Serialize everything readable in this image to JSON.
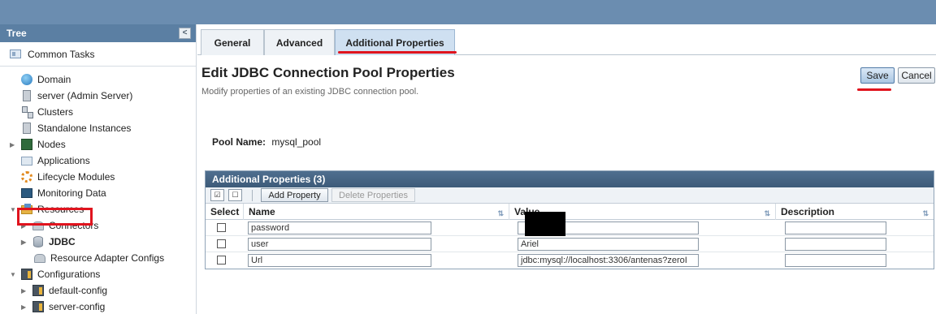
{
  "tree": {
    "header": "Tree",
    "collapse_glyph": "<",
    "common_tasks": "Common Tasks",
    "items": [
      {
        "label": "Domain",
        "icon": "globe-icon"
      },
      {
        "label": "server (Admin Server)",
        "icon": "server-icon"
      },
      {
        "label": "Clusters",
        "icon": "clusters-icon"
      },
      {
        "label": "Standalone Instances",
        "icon": "server-icon"
      },
      {
        "label": "Nodes",
        "icon": "nodes-icon"
      },
      {
        "label": "Applications",
        "icon": "applications-icon"
      },
      {
        "label": "Lifecycle Modules",
        "icon": "lifecycle-icon"
      },
      {
        "label": "Monitoring Data",
        "icon": "monitoring-icon"
      },
      {
        "label": "Resources",
        "icon": "resources-icon"
      },
      {
        "label": "Connectors",
        "icon": "connectors-icon"
      },
      {
        "label": "JDBC",
        "icon": "database-icon"
      },
      {
        "label": "Resource Adapter Configs",
        "icon": "connectors-icon"
      },
      {
        "label": "Configurations",
        "icon": "configuration-icon"
      },
      {
        "label": "default-config",
        "icon": "configuration-icon"
      },
      {
        "label": "server-config",
        "icon": "configuration-icon"
      }
    ]
  },
  "tabs": [
    {
      "label": "General"
    },
    {
      "label": "Advanced"
    },
    {
      "label": "Additional Properties",
      "active": true
    }
  ],
  "page": {
    "title": "Edit JDBC Connection Pool Properties",
    "description": "Modify properties of an existing JDBC connection pool.",
    "save_label": "Save",
    "cancel_label": "Cancel",
    "pool_name_label": "Pool Name:",
    "pool_name_value": "mysql_pool"
  },
  "properties": {
    "title": "Additional Properties (3)",
    "add_label": "Add Property",
    "delete_label": "Delete Properties",
    "columns": {
      "select": "Select",
      "name": "Name",
      "value": "Value",
      "description": "Description"
    },
    "rows": [
      {
        "name": "password",
        "value": "",
        "description": ""
      },
      {
        "name": "user",
        "value": "Ariel",
        "description": ""
      },
      {
        "name": "Url",
        "value": "jdbc:mysql://localhost:3306/antenas?zeroI",
        "description": ""
      }
    ]
  },
  "colors": {
    "topbar": "#6b8db0",
    "tree_header": "#5b7fa3",
    "table_header": "#4f6f8f",
    "highlight": "#e0141e"
  }
}
